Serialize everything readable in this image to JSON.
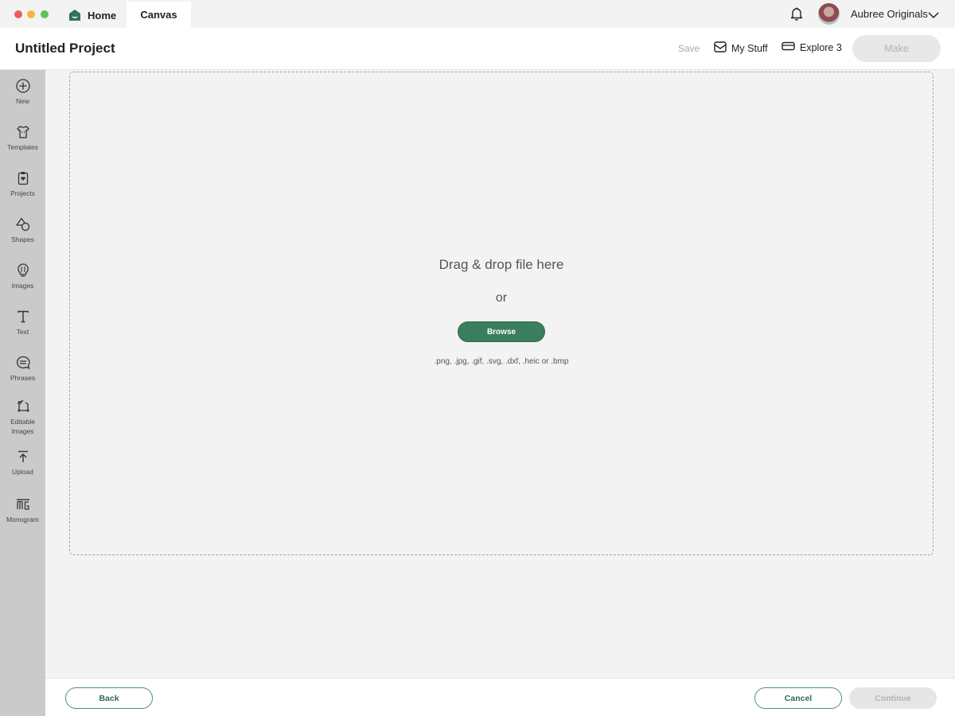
{
  "titlebar": {
    "tabs": [
      {
        "label": "Home",
        "icon": "home-icon"
      },
      {
        "label": "Canvas",
        "active": true
      }
    ],
    "user": {
      "name": "Aubree Originals",
      "avatar": "avatar"
    },
    "icons": {
      "notifications": "bell-icon",
      "dropdown": "chevron-down-icon"
    }
  },
  "header": {
    "title": "Untitled Project",
    "save_label": "Save",
    "mystuff_label": "My Stuff",
    "machine_label": "Explore 3",
    "make_label": "Make"
  },
  "sidebar": {
    "items": [
      {
        "label": "New",
        "icon": "plus-circle-icon"
      },
      {
        "label": "Templates",
        "icon": "shirt-icon"
      },
      {
        "label": "Projects",
        "icon": "clipboard-heart-icon"
      },
      {
        "label": "Shapes",
        "icon": "shapes-icon"
      },
      {
        "label": "Images",
        "icon": "lightbulb-icon"
      },
      {
        "label": "Text",
        "icon": "text-icon"
      },
      {
        "label": "Phrases",
        "icon": "speech-bubble-icon"
      },
      {
        "label": "Editable Images",
        "icon": "vector-edit-icon"
      },
      {
        "label": "Upload",
        "icon": "upload-icon"
      },
      {
        "label": "Monogram",
        "icon": "monogram-icon"
      }
    ]
  },
  "dropzone": {
    "title": "Drag & drop file here",
    "or": "or",
    "browse_label": "Browse",
    "formats": ".png, .jpg, .gif, .svg, .dxf, .heic or .bmp"
  },
  "footer": {
    "back_label": "Back",
    "cancel_label": "Cancel",
    "continue_label": "Continue"
  },
  "colors": {
    "brand_green": "#3b7e5f",
    "sidebar_bg": "#cacaca",
    "disabled_bg": "#e6e6e6"
  }
}
